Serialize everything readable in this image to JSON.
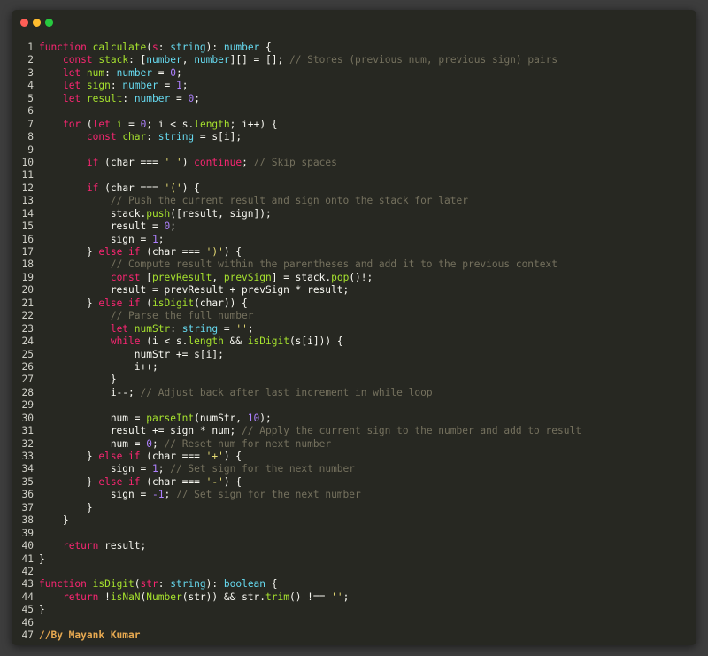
{
  "window": {
    "controls": [
      {
        "name": "close",
        "color": "#ff5f56"
      },
      {
        "name": "minimize",
        "color": "#ffbd2e"
      },
      {
        "name": "maximize",
        "color": "#27c93f"
      }
    ]
  },
  "code": {
    "lines": [
      {
        "n": "1",
        "tokens": [
          [
            "kw",
            "function "
          ],
          [
            "fn",
            "calculate"
          ],
          [
            "pl",
            "("
          ],
          [
            "kw",
            "s"
          ],
          [
            "pl",
            ": "
          ],
          [
            "ty",
            "string"
          ],
          [
            "pl",
            "): "
          ],
          [
            "ty",
            "number"
          ],
          [
            "pl",
            " {"
          ]
        ]
      },
      {
        "n": "2",
        "tokens": [
          [
            "pl",
            "    "
          ],
          [
            "kw",
            "const "
          ],
          [
            "fn",
            "stack"
          ],
          [
            "pl",
            ": ["
          ],
          [
            "ty",
            "number"
          ],
          [
            "pl",
            ", "
          ],
          [
            "ty",
            "number"
          ],
          [
            "pl",
            "][] = []; "
          ],
          [
            "cm",
            "// Stores (previous num, previous sign) pairs"
          ]
        ]
      },
      {
        "n": "3",
        "tokens": [
          [
            "pl",
            "    "
          ],
          [
            "kw",
            "let "
          ],
          [
            "fn",
            "num"
          ],
          [
            "pl",
            ": "
          ],
          [
            "ty",
            "number"
          ],
          [
            "pl",
            " = "
          ],
          [
            "num",
            "0"
          ],
          [
            "pl",
            ";"
          ]
        ]
      },
      {
        "n": "4",
        "tokens": [
          [
            "pl",
            "    "
          ],
          [
            "kw",
            "let "
          ],
          [
            "fn",
            "sign"
          ],
          [
            "pl",
            ": "
          ],
          [
            "ty",
            "number"
          ],
          [
            "pl",
            " = "
          ],
          [
            "num",
            "1"
          ],
          [
            "pl",
            ";"
          ]
        ]
      },
      {
        "n": "5",
        "tokens": [
          [
            "pl",
            "    "
          ],
          [
            "kw",
            "let "
          ],
          [
            "fn",
            "result"
          ],
          [
            "pl",
            ": "
          ],
          [
            "ty",
            "number"
          ],
          [
            "pl",
            " = "
          ],
          [
            "num",
            "0"
          ],
          [
            "pl",
            ";"
          ]
        ]
      },
      {
        "n": "6",
        "tokens": []
      },
      {
        "n": "7",
        "tokens": [
          [
            "pl",
            "    "
          ],
          [
            "kw",
            "for"
          ],
          [
            "pl",
            " ("
          ],
          [
            "kw",
            "let "
          ],
          [
            "fn",
            "i"
          ],
          [
            "pl",
            " = "
          ],
          [
            "num",
            "0"
          ],
          [
            "pl",
            "; i < s."
          ],
          [
            "fn",
            "length"
          ],
          [
            "pl",
            "; i++) {"
          ]
        ]
      },
      {
        "n": "8",
        "tokens": [
          [
            "pl",
            "        "
          ],
          [
            "kw",
            "const "
          ],
          [
            "fn",
            "char"
          ],
          [
            "pl",
            ": "
          ],
          [
            "ty",
            "string"
          ],
          [
            "pl",
            " = s[i];"
          ]
        ]
      },
      {
        "n": "9",
        "tokens": []
      },
      {
        "n": "10",
        "tokens": [
          [
            "pl",
            "        "
          ],
          [
            "kw",
            "if"
          ],
          [
            "pl",
            " (char === "
          ],
          [
            "str",
            "' '"
          ],
          [
            "pl",
            ") "
          ],
          [
            "kw",
            "continue"
          ],
          [
            "pl",
            "; "
          ],
          [
            "cm",
            "// Skip spaces"
          ]
        ]
      },
      {
        "n": "11",
        "tokens": []
      },
      {
        "n": "12",
        "tokens": [
          [
            "pl",
            "        "
          ],
          [
            "kw",
            "if"
          ],
          [
            "pl",
            " (char === "
          ],
          [
            "str",
            "'('"
          ],
          [
            "pl",
            ") {"
          ]
        ]
      },
      {
        "n": "13",
        "tokens": [
          [
            "pl",
            "            "
          ],
          [
            "cm",
            "// Push the current result and sign onto the stack for later"
          ]
        ]
      },
      {
        "n": "14",
        "tokens": [
          [
            "pl",
            "            stack."
          ],
          [
            "fn",
            "push"
          ],
          [
            "pl",
            "([result, sign]);"
          ]
        ]
      },
      {
        "n": "15",
        "tokens": [
          [
            "pl",
            "            result = "
          ],
          [
            "num",
            "0"
          ],
          [
            "pl",
            ";"
          ]
        ]
      },
      {
        "n": "16",
        "tokens": [
          [
            "pl",
            "            sign = "
          ],
          [
            "num",
            "1"
          ],
          [
            "pl",
            ";"
          ]
        ]
      },
      {
        "n": "17",
        "tokens": [
          [
            "pl",
            "        } "
          ],
          [
            "kw",
            "else if"
          ],
          [
            "pl",
            " (char === "
          ],
          [
            "str",
            "')'"
          ],
          [
            "pl",
            ") {"
          ]
        ]
      },
      {
        "n": "18",
        "tokens": [
          [
            "pl",
            "            "
          ],
          [
            "cm",
            "// Compute result within the parentheses and add it to the previous context"
          ]
        ]
      },
      {
        "n": "19",
        "tokens": [
          [
            "pl",
            "            "
          ],
          [
            "kw",
            "const "
          ],
          [
            "pl",
            "["
          ],
          [
            "fn",
            "prevResult"
          ],
          [
            "pl",
            ", "
          ],
          [
            "fn",
            "prevSign"
          ],
          [
            "pl",
            "] = stack."
          ],
          [
            "fn",
            "pop"
          ],
          [
            "pl",
            "()!;"
          ]
        ]
      },
      {
        "n": "20",
        "tokens": [
          [
            "pl",
            "            result = prevResult + prevSign * result;"
          ]
        ]
      },
      {
        "n": "21",
        "tokens": [
          [
            "pl",
            "        } "
          ],
          [
            "kw",
            "else if"
          ],
          [
            "pl",
            " ("
          ],
          [
            "fn",
            "isDigit"
          ],
          [
            "pl",
            "(char)) {"
          ]
        ]
      },
      {
        "n": "22",
        "tokens": [
          [
            "pl",
            "            "
          ],
          [
            "cm",
            "// Parse the full number"
          ]
        ]
      },
      {
        "n": "23",
        "tokens": [
          [
            "pl",
            "            "
          ],
          [
            "kw",
            "let "
          ],
          [
            "fn",
            "numStr"
          ],
          [
            "pl",
            ": "
          ],
          [
            "ty",
            "string"
          ],
          [
            "pl",
            " = "
          ],
          [
            "str",
            "''"
          ],
          [
            "pl",
            ";"
          ]
        ]
      },
      {
        "n": "24",
        "tokens": [
          [
            "pl",
            "            "
          ],
          [
            "kw",
            "while"
          ],
          [
            "pl",
            " (i < s."
          ],
          [
            "fn",
            "length"
          ],
          [
            "pl",
            " && "
          ],
          [
            "fn",
            "isDigit"
          ],
          [
            "pl",
            "(s[i])) {"
          ]
        ]
      },
      {
        "n": "25",
        "tokens": [
          [
            "pl",
            "                numStr += s[i];"
          ]
        ]
      },
      {
        "n": "26",
        "tokens": [
          [
            "pl",
            "                i++;"
          ]
        ]
      },
      {
        "n": "27",
        "tokens": [
          [
            "pl",
            "            }"
          ]
        ]
      },
      {
        "n": "28",
        "tokens": [
          [
            "pl",
            "            i--; "
          ],
          [
            "cm",
            "// Adjust back after last increment in while loop"
          ]
        ]
      },
      {
        "n": "29",
        "tokens": []
      },
      {
        "n": "30",
        "tokens": [
          [
            "pl",
            "            num = "
          ],
          [
            "fn",
            "parseInt"
          ],
          [
            "pl",
            "(numStr, "
          ],
          [
            "num",
            "10"
          ],
          [
            "pl",
            ");"
          ]
        ]
      },
      {
        "n": "31",
        "tokens": [
          [
            "pl",
            "            result += sign * num; "
          ],
          [
            "cm",
            "// Apply the current sign to the number and add to result"
          ]
        ]
      },
      {
        "n": "32",
        "tokens": [
          [
            "pl",
            "            num = "
          ],
          [
            "num",
            "0"
          ],
          [
            "pl",
            "; "
          ],
          [
            "cm",
            "// Reset num for next number"
          ]
        ]
      },
      {
        "n": "33",
        "tokens": [
          [
            "pl",
            "        } "
          ],
          [
            "kw",
            "else if"
          ],
          [
            "pl",
            " (char === "
          ],
          [
            "str",
            "'+'"
          ],
          [
            "pl",
            ") {"
          ]
        ]
      },
      {
        "n": "34",
        "tokens": [
          [
            "pl",
            "            sign = "
          ],
          [
            "num",
            "1"
          ],
          [
            "pl",
            "; "
          ],
          [
            "cm",
            "// Set sign for the next number"
          ]
        ]
      },
      {
        "n": "35",
        "tokens": [
          [
            "pl",
            "        } "
          ],
          [
            "kw",
            "else if"
          ],
          [
            "pl",
            " (char === "
          ],
          [
            "str",
            "'-'"
          ],
          [
            "pl",
            ") {"
          ]
        ]
      },
      {
        "n": "36",
        "tokens": [
          [
            "pl",
            "            sign = "
          ],
          [
            "num",
            "-1"
          ],
          [
            "pl",
            "; "
          ],
          [
            "cm",
            "// Set sign for the next number"
          ]
        ]
      },
      {
        "n": "37",
        "tokens": [
          [
            "pl",
            "        }"
          ]
        ]
      },
      {
        "n": "38",
        "tokens": [
          [
            "pl",
            "    }"
          ]
        ]
      },
      {
        "n": "39",
        "tokens": []
      },
      {
        "n": "40",
        "tokens": [
          [
            "pl",
            "    "
          ],
          [
            "kw",
            "return "
          ],
          [
            "pl",
            "result;"
          ]
        ]
      },
      {
        "n": "41",
        "tokens": [
          [
            "pl",
            "}"
          ]
        ]
      },
      {
        "n": "42",
        "tokens": []
      },
      {
        "n": "43",
        "tokens": [
          [
            "kw",
            "function "
          ],
          [
            "fn",
            "isDigit"
          ],
          [
            "pl",
            "("
          ],
          [
            "kw",
            "str"
          ],
          [
            "pl",
            ": "
          ],
          [
            "ty",
            "string"
          ],
          [
            "pl",
            "): "
          ],
          [
            "ty",
            "boolean"
          ],
          [
            "pl",
            " {"
          ]
        ]
      },
      {
        "n": "44",
        "tokens": [
          [
            "pl",
            "    "
          ],
          [
            "kw",
            "return "
          ],
          [
            "pl",
            "!"
          ],
          [
            "fn",
            "isNaN"
          ],
          [
            "pl",
            "("
          ],
          [
            "fn",
            "Number"
          ],
          [
            "pl",
            "(str)) && str."
          ],
          [
            "fn",
            "trim"
          ],
          [
            "pl",
            "() !== "
          ],
          [
            "str",
            "''"
          ],
          [
            "pl",
            ";"
          ]
        ]
      },
      {
        "n": "45",
        "tokens": [
          [
            "pl",
            "}"
          ]
        ]
      },
      {
        "n": "46",
        "tokens": []
      },
      {
        "n": "47",
        "tokens": [
          [
            "sg",
            "//By Mayank Kumar"
          ]
        ]
      }
    ]
  }
}
